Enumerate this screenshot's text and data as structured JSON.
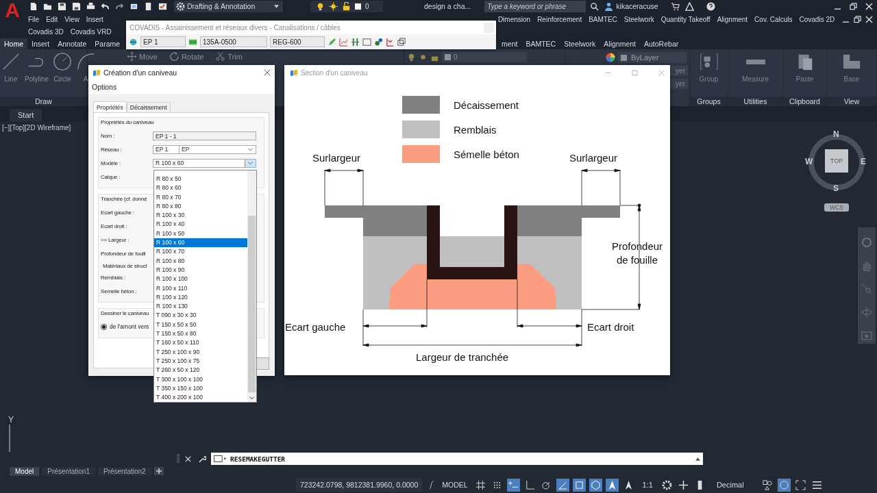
{
  "app": {
    "logo_letter": "A",
    "workspace": "Drafting & Annotation",
    "layer_quick": "0",
    "document_title": "design a cha...",
    "search": {
      "placeholder": "Type a keyword or phrase"
    },
    "user": "kikaceracuse"
  },
  "menu_bar": {
    "items_left": [
      "File",
      "Edit",
      "View",
      "Insert"
    ],
    "items_right": [
      "Dimension",
      "Reinforcement",
      "BAMTEC",
      "Steelwork",
      "Quantity Takeoff",
      "Alignment",
      "Cov. Calculs",
      "Covadis 2D"
    ],
    "items_row_2": [
      "Covadis 3D",
      "Covadis VRD"
    ]
  },
  "ribbon": {
    "tabs_left": [
      {
        "label": "Home",
        "selected": true
      },
      {
        "label": "Insert",
        "selected": false
      },
      {
        "label": "Annotate",
        "selected": false
      },
      {
        "label": "Parame",
        "selected": false
      }
    ],
    "tabs_right": [
      {
        "label": "ment",
        "selected": false
      },
      {
        "label": "BAMTEC",
        "selected": false
      },
      {
        "label": "Steelwork",
        "selected": false
      },
      {
        "label": "Alignment",
        "selected": false
      },
      {
        "label": "AutoRebar",
        "selected": false
      }
    ],
    "draw_tools": [
      {
        "label": "Line",
        "kind": "line"
      },
      {
        "label": "Polyline",
        "kind": "polyline"
      },
      {
        "label": "Circle",
        "kind": "circle"
      },
      {
        "label": "A",
        "kind": "arc"
      }
    ],
    "modify_tools": [
      {
        "label": "Move",
        "kind": "move"
      },
      {
        "label": "Rotate",
        "kind": "rotate"
      },
      {
        "label": "Trim",
        "kind": "trim"
      }
    ],
    "layer_name": "0",
    "color_value": "ByLayer",
    "linetype_value": "yer",
    "lineweight_value": "yer",
    "right_tools": [
      {
        "label": "Group",
        "kind": "group"
      },
      {
        "label": "Measure",
        "kind": "measure"
      },
      {
        "label": "Paste",
        "kind": "paste"
      },
      {
        "label": "Base",
        "kind": "base"
      }
    ],
    "draw_panel": "Draw",
    "right_panels": [
      "Groups",
      "Utilities",
      "Clipboard",
      "View"
    ]
  },
  "file_tab": "Start",
  "viewport": {
    "label": "[−][Top][2D Wireframe]",
    "ucs_y": "Y",
    "viewcube": {
      "n": "N",
      "s": "S",
      "e": "E",
      "w": "W",
      "face": "TOP",
      "ucs": "WCS"
    }
  },
  "covadis_toolbar": {
    "title": "COVADIS - Assainissement et réseaux divers - Canalisations / câbles",
    "network": "EP 1",
    "pipe": "135A-0500",
    "manhole": "REG-600"
  },
  "dialog": {
    "title": "Création d'un caniveau",
    "menu": "Options",
    "tabs": [
      {
        "label": "Propriétés",
        "selected": true
      },
      {
        "label": "Décaissement",
        "selected": false
      }
    ],
    "group_1": "Propriétés du caniveau",
    "nom": {
      "label": "Nom :",
      "value": "EP 1 - 1"
    },
    "reseau": {
      "label": "Réseau :",
      "code": "EP 1",
      "name": "EP"
    },
    "modele": {
      "label": "Modèle :",
      "value": "R 100 x 60",
      "expanded": true,
      "options": [
        {
          "label": "R 80 x 50",
          "selected": false
        },
        {
          "label": "R 80 x 60",
          "selected": false
        },
        {
          "label": "R 80 x 70",
          "selected": false
        },
        {
          "label": "R 80 x 80",
          "selected": false
        },
        {
          "label": "R 100 x 30",
          "selected": false
        },
        {
          "label": "R 100 x 40",
          "selected": false
        },
        {
          "label": "R 100 x 50",
          "selected": false
        },
        {
          "label": "R 100 x 60",
          "selected": true
        },
        {
          "label": "R 100 x 70",
          "selected": false
        },
        {
          "label": "R 100 x 80",
          "selected": false
        },
        {
          "label": "R 100 x 90",
          "selected": false
        },
        {
          "label": "R 100 x 100",
          "selected": false
        },
        {
          "label": "R 100 x 110",
          "selected": false
        },
        {
          "label": "R 100 x 120",
          "selected": false
        },
        {
          "label": "R 100 x 130",
          "selected": false
        },
        {
          "label": "T 090 x 30 x 30",
          "selected": false
        },
        {
          "label": "T 150 x 50 x 50",
          "selected": false
        },
        {
          "label": "T 150 x 50 x 80",
          "selected": false
        },
        {
          "label": "T 160 x 50 x 110",
          "selected": false
        },
        {
          "label": "T 250 x 100 x 90",
          "selected": false
        },
        {
          "label": "T 250 x 100 x 75",
          "selected": false
        },
        {
          "label": "T 260 x 50 x 120",
          "selected": false
        },
        {
          "label": "T 300 x 100 x 100",
          "selected": false
        },
        {
          "label": "T 350 x 150 x 100",
          "selected": false
        },
        {
          "label": "T 400 x 200 x 100",
          "selected": false
        }
      ]
    },
    "calque_label": "Calque :",
    "group_2": "Tranchée (cf. donné",
    "fields_2": [
      "Ecart gauche :",
      "Ecart droit :",
      "=> Largeur :",
      "Profondeur de fouill"
    ],
    "group_3": "Matériaux de struct",
    "fields_3": [
      "Remblais :",
      "Semelle béton :"
    ],
    "group_4": "Dessiner le caniveau",
    "direction": {
      "label": "de l'amont vers",
      "selected": true
    }
  },
  "section_window": {
    "title": "Section d'un caniveau",
    "legend": [
      {
        "label": "Décaissement",
        "color": "#808080"
      },
      {
        "label": "Remblais",
        "color": "#c0c0c0"
      },
      {
        "label": "Sémelle béton",
        "color": "#fa9d80"
      }
    ],
    "labels": {
      "surlargeur_left": "Surlargeur",
      "surlargeur_right": "Surlargeur",
      "profondeur": [
        "Profondeur",
        "de fouille"
      ],
      "ecart_gauche": "Ecart gauche",
      "ecart_droit": "Ecart droit",
      "largeur": "Largeur de tranchée"
    }
  },
  "command_line": {
    "value": "RESEMAKEGUTTER"
  },
  "layout_tabs": [
    {
      "label": "Model",
      "selected": true
    },
    {
      "label": "Présentation1",
      "selected": false
    },
    {
      "label": "Présentation2",
      "selected": false
    }
  ],
  "status_bar": {
    "coordinates": "723242.0798, 9812381.9960, 0.0000",
    "space": "MODEL",
    "scale": "1:1",
    "units": "Decimal"
  }
}
